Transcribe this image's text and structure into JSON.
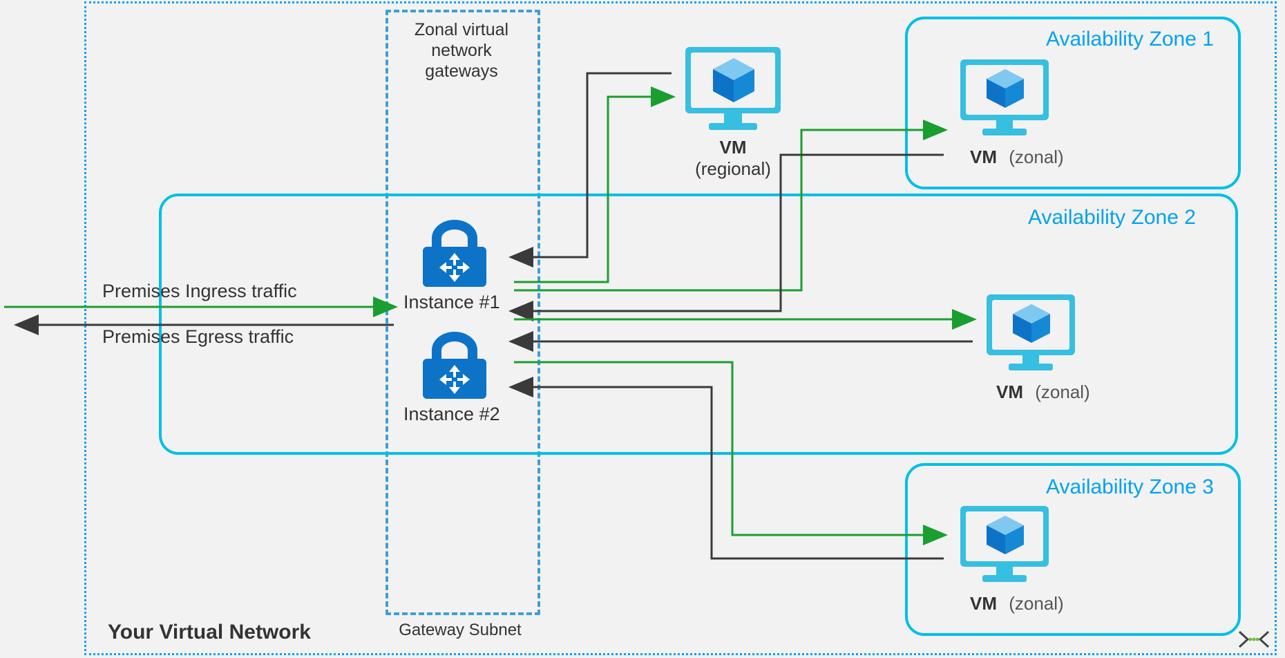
{
  "vnet": {
    "title": "Your Virtual Network"
  },
  "gateway": {
    "title": "Zonal virtual\nnetwork gateways",
    "subnet_label": "Gateway Subnet",
    "instance1": "Instance #1",
    "instance2": "Instance #2"
  },
  "traffic": {
    "ingress": "Premises Ingress traffic",
    "egress": "Premises Egress traffic"
  },
  "vms": {
    "regional": {
      "title": "VM",
      "subtitle": "(regional)"
    },
    "zonal": {
      "title": "VM",
      "subtitle": "(zonal)"
    }
  },
  "zones": {
    "z1": "Availability Zone 1",
    "z2": "Availability Zone 2",
    "z3": "Availability Zone 3"
  },
  "colors": {
    "azure_blue": "#00a2ed",
    "azure_cyan": "#00bfe6",
    "green": "#1a9e2f",
    "dark": "#3a3a3a"
  }
}
